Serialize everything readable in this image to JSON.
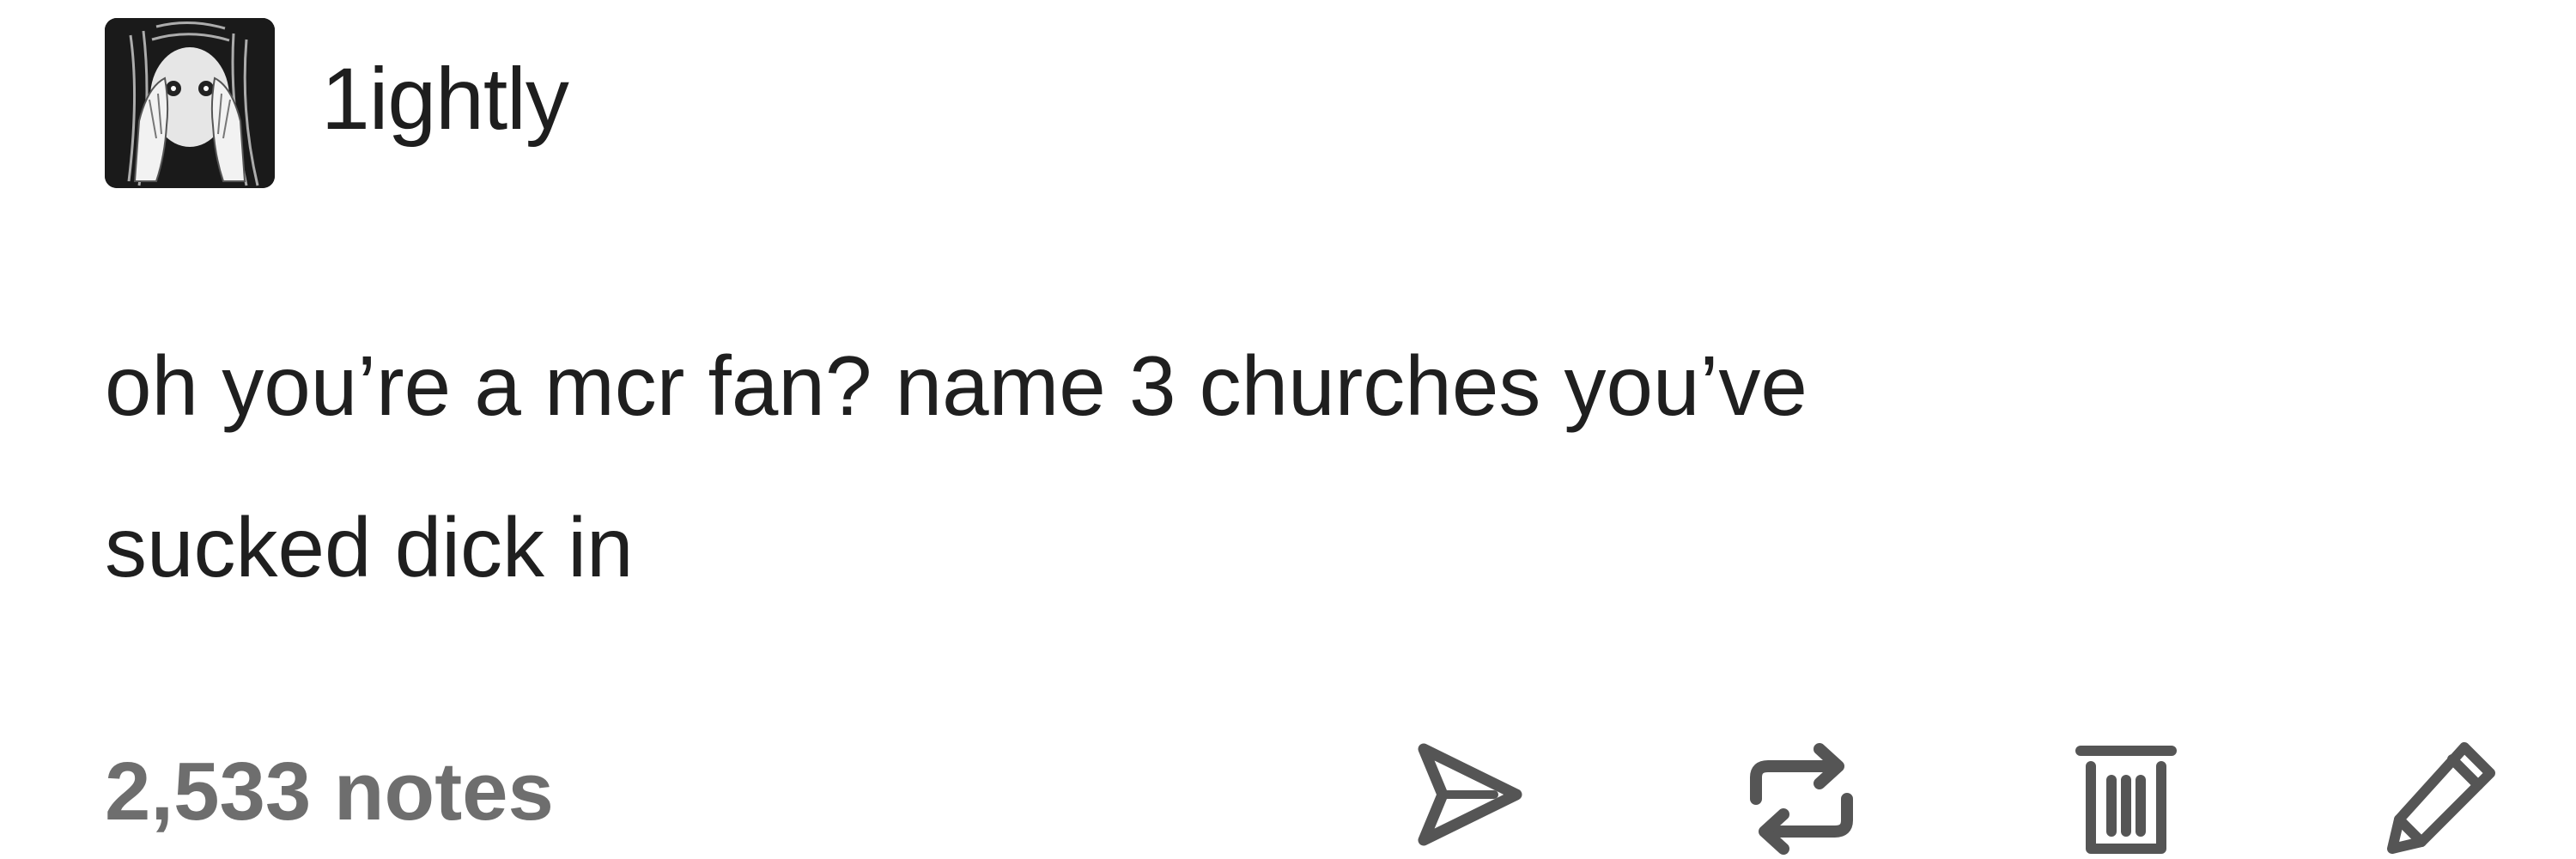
{
  "post": {
    "username": "1ightly",
    "body": "oh you’re a mcr fan? name 3 churches you’ve\nsucked dick in",
    "footer": {
      "notes_label": "2,533 notes"
    },
    "actions": [
      {
        "name": "share",
        "icon": "send-icon"
      },
      {
        "name": "reblog",
        "icon": "reblog-icon"
      },
      {
        "name": "delete",
        "icon": "trash-icon"
      },
      {
        "name": "edit",
        "icon": "pencil-icon"
      }
    ]
  },
  "colors": {
    "text": "#1f1f1f",
    "muted": "#6e6e6e",
    "icon": "#555555",
    "background": "#ffffff"
  }
}
